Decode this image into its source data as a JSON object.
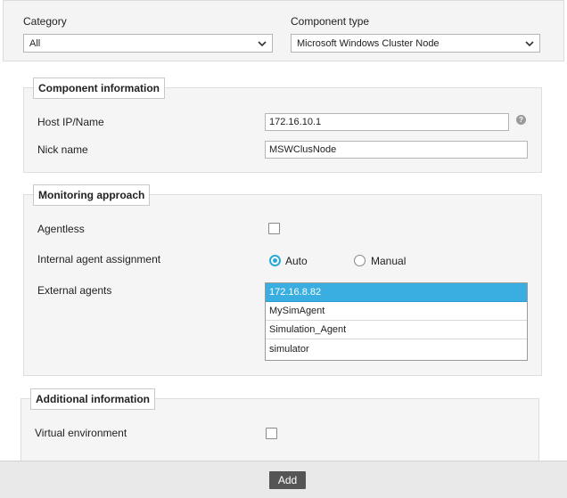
{
  "filters": {
    "category_label": "Category",
    "category_value": "All",
    "component_type_label": "Component type",
    "component_type_value": "Microsoft Windows Cluster Node"
  },
  "component_info": {
    "legend": "Component information",
    "host_label": "Host IP/Name",
    "host_value": "172.16.10.1",
    "help_icon": "?",
    "nick_label": "Nick name",
    "nick_value": "MSWClusNode"
  },
  "monitoring": {
    "legend": "Monitoring approach",
    "agentless_label": "Agentless",
    "agentless_checked": false,
    "assignment_label": "Internal agent assignment",
    "auto_label": "Auto",
    "manual_label": "Manual",
    "selected_assignment": "Auto",
    "external_label": "External agents",
    "agents": [
      "172.16.8.82",
      "MySimAgent",
      "Simulation_Agent",
      "simulator"
    ],
    "selected_agent": "172.16.8.82"
  },
  "additional": {
    "legend": "Additional information",
    "virtual_label": "Virtual environment",
    "virtual_checked": false
  },
  "footer": {
    "add_label": "Add"
  },
  "colors": {
    "accent": "#29a8d8",
    "selection": "#3aaee0",
    "button": "#555555"
  }
}
